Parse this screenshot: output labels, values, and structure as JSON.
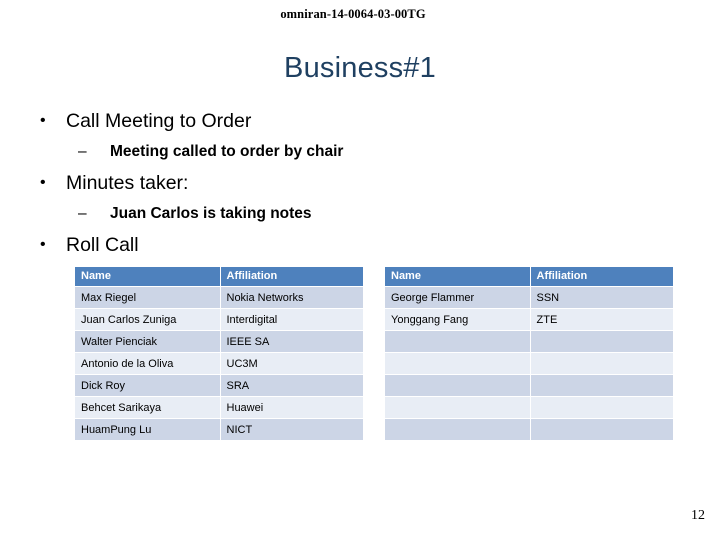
{
  "document": {
    "header_id": "omniran-14-0064-03-00TG",
    "page_number": "12"
  },
  "slide": {
    "title": "Business#1",
    "title_color": "#1f4061",
    "accent_color": "#4e81bd",
    "row_dark_color": "#ccd5e6",
    "row_light_color": "#e8edf5"
  },
  "bullets": [
    {
      "level": 1,
      "marker": "•",
      "text": "Call Meeting to Order"
    },
    {
      "level": 2,
      "marker": "–",
      "text": "Meeting called to order by chair"
    },
    {
      "level": 1,
      "marker": "•",
      "text": "Minutes taker:"
    },
    {
      "level": 2,
      "marker": "–",
      "text": "Juan Carlos is taking notes"
    },
    {
      "level": 1,
      "marker": "•",
      "text": "Roll Call"
    }
  ],
  "tables": [
    {
      "id": "attendance-table-left",
      "columns": [
        "Name",
        "Affiliation"
      ],
      "rows": [
        [
          "Max Riegel",
          "Nokia Networks"
        ],
        [
          "Juan Carlos Zuniga",
          "Interdigital"
        ],
        [
          "Walter Pienciak",
          "IEEE SA"
        ],
        [
          "Antonio de la Oliva",
          "UC3M"
        ],
        [
          "Dick Roy",
          "SRA"
        ],
        [
          "Behcet Sarikaya",
          "Huawei"
        ],
        [
          "HuamPung Lu",
          "NICT"
        ]
      ]
    },
    {
      "id": "attendance-table-right",
      "columns": [
        "Name",
        "Affiliation"
      ],
      "rows": [
        [
          "George Flammer",
          "SSN"
        ],
        [
          "Yonggang Fang",
          "ZTE"
        ],
        [
          "",
          ""
        ],
        [
          "",
          ""
        ],
        [
          "",
          ""
        ],
        [
          "",
          ""
        ],
        [
          "",
          ""
        ]
      ]
    }
  ]
}
